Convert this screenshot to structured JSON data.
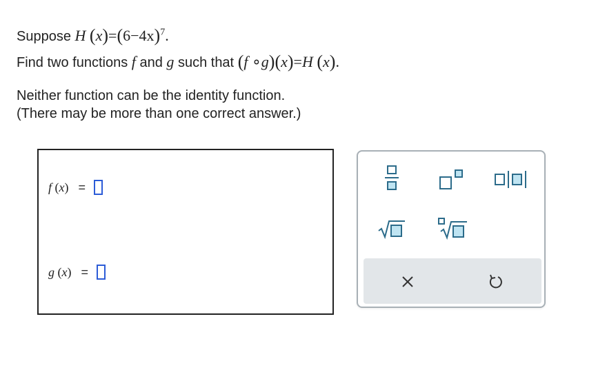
{
  "problem": {
    "line1_prefix": "Suppose",
    "H": "H",
    "x": "x",
    "eq": "=",
    "six": "6",
    "minus": "−",
    "four_x": "4x",
    "exponent": "7",
    "period": ".",
    "line2_prefix": "Find two functions",
    "f": "f",
    "and": "and",
    "g": "g",
    "such_that": "such that",
    "compose": "∘",
    "note1": "Neither function can be the identity function.",
    "note2": "(There may be more than one correct answer.)"
  },
  "answer": {
    "f_label": "f",
    "g_label": "g",
    "x": "x",
    "equals": "="
  },
  "palette": {
    "buttons": [
      "fraction-icon",
      "superscript-icon",
      "absolute-value-icon",
      "square-root-icon",
      "nth-root-icon"
    ],
    "actions": [
      "clear-icon",
      "undo-icon"
    ],
    "clear_symbol": "×",
    "colors": {
      "slot_border": "#2b5bd7",
      "icon_border": "#2b6b8a",
      "icon_fill": "#bfe4f2",
      "action_bar": "#e2e6e9"
    }
  }
}
